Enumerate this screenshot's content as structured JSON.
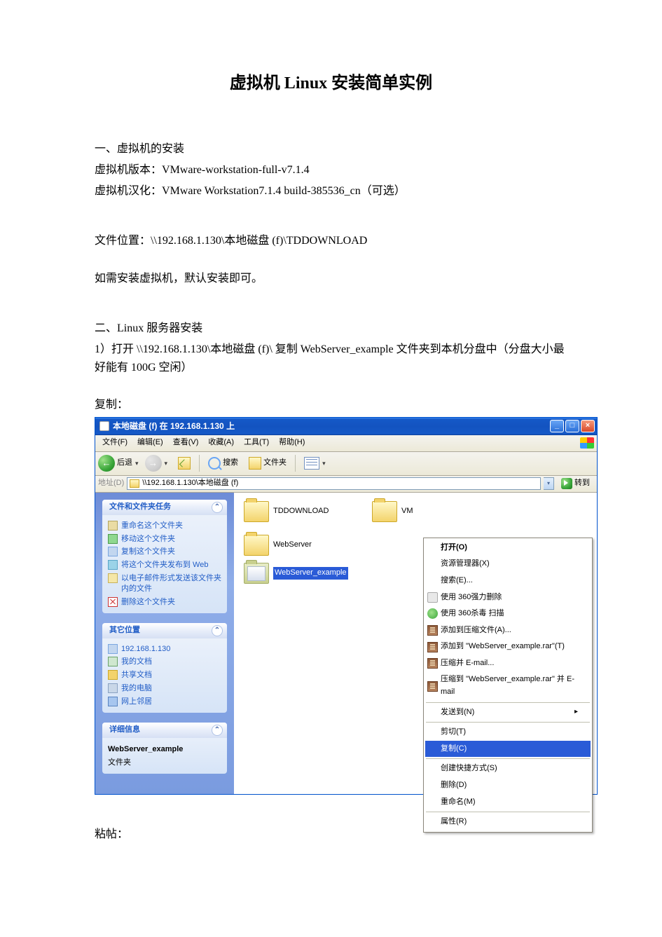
{
  "title": "虚拟机 Linux  安装简单实例",
  "section1": {
    "heading": "一、虚拟机的安装",
    "l1_label": "虚拟机版本：",
    "l1_value": "VMware-workstation-full-v7.1.4",
    "l2_label": "虚拟机汉化：",
    "l2_value": "VMware Workstation7.1.4 build-385536_cn（可选）",
    "l3_label": "文件位置：",
    "l3_value": "\\\\192.168.1.130\\本地磁盘 (f)\\TDDOWNLOAD",
    "l4": "如需安装虚拟机，默认安装即可。"
  },
  "section2": {
    "heading": "二、Linux  服务器安装",
    "step1": "1）打开  \\\\192.168.1.130\\本地磁盘 (f)\\   复制 WebServer_example  文件夹到本机分盘中（分盘大小最好能有 100G 空闲）",
    "copy_label": "复制：",
    "paste_label": "粘帖："
  },
  "xp": {
    "title": "本地磁盘 (f) 在 192.168.1.130 上",
    "menu": {
      "file": "文件(F)",
      "edit": "编辑(E)",
      "view": "查看(V)",
      "fav": "收藏(A)",
      "tools": "工具(T)",
      "help": "帮助(H)"
    },
    "toolbar": {
      "back": "后退",
      "search": "搜索",
      "folders": "文件夹"
    },
    "address": {
      "label": "地址(D)",
      "value": "\\\\192.168.1.130\\本地磁盘 (f)",
      "go": "转到"
    },
    "sidebar": {
      "panel1": {
        "title": "文件和文件夹任务",
        "items": [
          "重命名这个文件夹",
          "移动这个文件夹",
          "复制这个文件夹",
          "将这个文件夹发布到 Web",
          "以电子邮件形式发送该文件夹内的文件",
          "删除这个文件夹"
        ]
      },
      "panel2": {
        "title": "其它位置",
        "items": [
          "192.168.1.130",
          "我的文档",
          "共享文档",
          "我的电脑",
          "网上邻居"
        ]
      },
      "panel3": {
        "title": "详细信息",
        "name": "WebServer_example",
        "type": "文件夹"
      }
    },
    "folders": [
      "TDDOWNLOAD",
      "VM",
      "WebServer",
      "WebServer_example"
    ],
    "ctx": {
      "open": "打开(O)",
      "explorer": "资源管理器(X)",
      "search": "搜索(E)...",
      "shred": "使用 360强力删除",
      "scan": "使用 360杀毒 扫描",
      "addarchive": "添加到压缩文件(A)...",
      "addrar": "添加到 \"WebServer_example.rar\"(T)",
      "zipemail": "压缩并 E-mail...",
      "zipraremail": "压缩到 \"WebServer_example.rar\" 并 E-mail",
      "sendto": "发送到(N)",
      "cut": "剪切(T)",
      "copy": "复制(C)",
      "shortcut": "创建快捷方式(S)",
      "delete": "删除(D)",
      "rename": "重命名(M)",
      "properties": "属性(R)"
    }
  }
}
